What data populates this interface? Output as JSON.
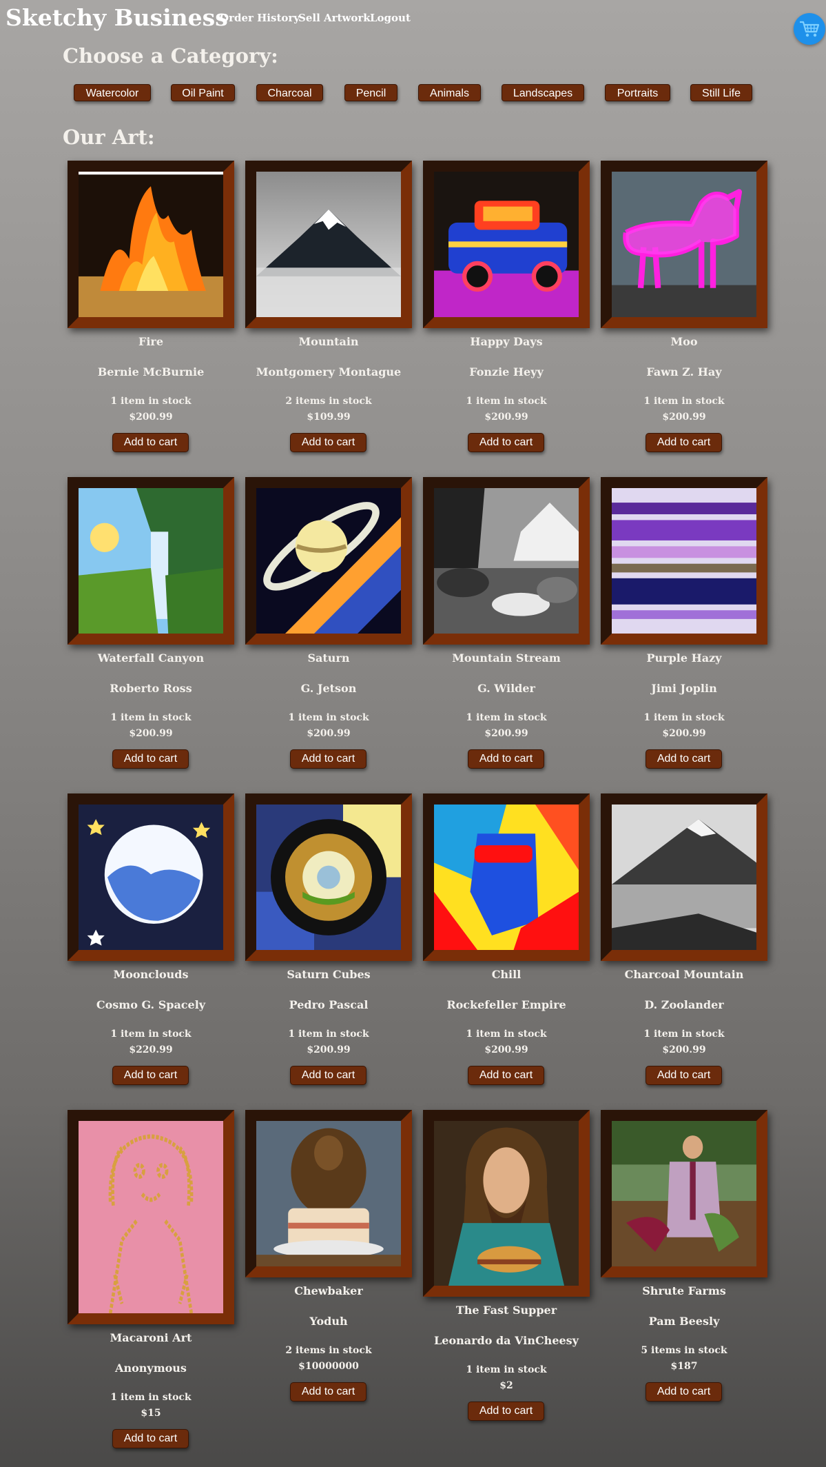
{
  "header": {
    "brand": "Sketchy Business",
    "nav": [
      "Order History",
      "Sell Artwork",
      "Logout"
    ],
    "cart_icon": "shopping-cart-icon"
  },
  "categories_heading": "Choose a Category:",
  "categories": [
    "Watercolor",
    "Oil Paint",
    "Charcoal",
    "Pencil",
    "Animals",
    "Landscapes",
    "Portraits",
    "Still Life"
  ],
  "art_heading": "Our Art:",
  "add_label": "Add to cart",
  "colors": {
    "button": "#6b2b0c",
    "frame_light": "#7a2e08",
    "frame_dark": "#2a1408",
    "cart": "#1e90ea"
  },
  "artworks": [
    {
      "title": "Fire",
      "artist": "Bernie McBurnie",
      "stock": "1 item in stock",
      "price": "$200.99"
    },
    {
      "title": "Mountain",
      "artist": "Montgomery Montague",
      "stock": "2 items in stock",
      "price": "$109.99"
    },
    {
      "title": "Happy Days",
      "artist": "Fonzie Heyy",
      "stock": "1 item in stock",
      "price": "$200.99"
    },
    {
      "title": "Moo",
      "artist": "Fawn Z. Hay",
      "stock": "1 item in stock",
      "price": "$200.99"
    },
    {
      "title": "Waterfall Canyon",
      "artist": "Roberto Ross",
      "stock": "1 item in stock",
      "price": "$200.99"
    },
    {
      "title": "Saturn",
      "artist": "G. Jetson",
      "stock": "1 item in stock",
      "price": "$200.99"
    },
    {
      "title": "Mountain Stream",
      "artist": "G. Wilder",
      "stock": "1 item in stock",
      "price": "$200.99"
    },
    {
      "title": "Purple Hazy",
      "artist": "Jimi Joplin",
      "stock": "1 item in stock",
      "price": "$200.99"
    },
    {
      "title": "Moonclouds",
      "artist": "Cosmo G. Spacely",
      "stock": "1 item in stock",
      "price": "$220.99"
    },
    {
      "title": "Saturn Cubes",
      "artist": "Pedro Pascal",
      "stock": "1 item in stock",
      "price": "$200.99"
    },
    {
      "title": "Chill",
      "artist": "Rockefeller Empire",
      "stock": "1 item in stock",
      "price": "$200.99"
    },
    {
      "title": "Charcoal Mountain",
      "artist": "D. Zoolander",
      "stock": "1 item in stock",
      "price": "$200.99"
    },
    {
      "title": "Macaroni Art",
      "artist": "Anonymous",
      "stock": "1 item in stock",
      "price": "$15"
    },
    {
      "title": "Chewbaker",
      "artist": "Yoduh",
      "stock": "2 items in stock",
      "price": "$10000000"
    },
    {
      "title": "The Fast Supper",
      "artist": "Leonardo da VinCheesy",
      "stock": "1 item in stock",
      "price": "$2"
    },
    {
      "title": "Shrute Farms",
      "artist": "Pam Beesly",
      "stock": "5 items in stock",
      "price": "$187"
    }
  ]
}
